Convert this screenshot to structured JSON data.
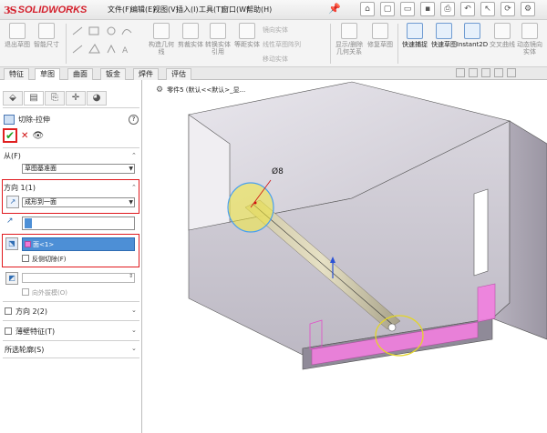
{
  "app": {
    "brand": "SOLIDWORKS"
  },
  "menu": [
    "文件(F)",
    "编辑(E)",
    "视图(V)",
    "插入(I)",
    "工具(T)",
    "窗口(W)",
    "帮助(H)"
  ],
  "ribbon": {
    "buttons": [
      {
        "label": "退出草图"
      },
      {
        "label": "智能尺寸"
      },
      {
        "label": "构造几何线"
      },
      {
        "label": "剪裁实体"
      },
      {
        "label": "转换实体引用"
      },
      {
        "label": "等距实体"
      },
      {
        "label": "显示/删除几何关系"
      },
      {
        "label": "修复草图"
      },
      {
        "label": "快速捕捉"
      },
      {
        "label": "快速草图"
      },
      {
        "label": "Instant2D"
      },
      {
        "label": "交叉曲线"
      },
      {
        "label": "动态镜向实体"
      }
    ],
    "row_mirror": "镜向实体",
    "row_linear": "线性草图阵列",
    "row_move": "移动实体"
  },
  "tabs": [
    "特征",
    "草图",
    "曲面",
    "钣金",
    "焊件",
    "评估"
  ],
  "active_tab": "草图",
  "property_manager": {
    "tabs_icons": [
      "featuremanager-icon",
      "propertymanager-icon",
      "configuration-icon",
      "dimxpert-icon",
      "appearance-icon"
    ],
    "feature_title": "切除-拉伸",
    "help": "?",
    "from_label": "从(F)",
    "from_value": "草图基准面",
    "dir1_label": "方向 1(1)",
    "end_condition": "成形到一面",
    "face_selection": "面<1>",
    "flip_side": "反侧切除(F)",
    "draft_outward": "向外拔模(O)",
    "dir2_label": "方向 2(2)",
    "thin_label": "薄壁特征(T)",
    "contours_label": "所选轮廓(S)"
  },
  "graphics": {
    "breadcrumb": "零件5 (默认<<默认>_显...",
    "dimension": "Ø8",
    "colors": {
      "part_body": "#d8d4dc",
      "part_dark": "#9b97a3",
      "selected_face": "#f27fe0",
      "sketch_circle": "#f2e93a",
      "highlight_circle": "#4aa0ef"
    }
  }
}
